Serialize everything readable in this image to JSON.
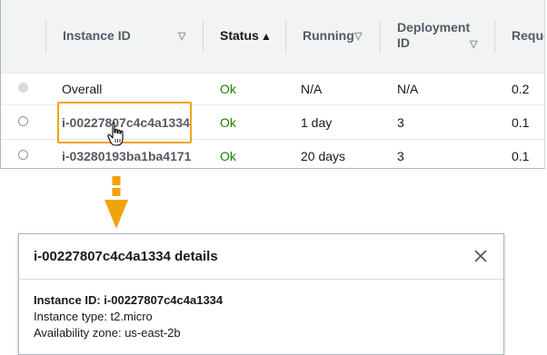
{
  "table": {
    "columns": [
      {
        "label": "Instance ID",
        "sort_icon": "triangle-down-icon"
      },
      {
        "label": "Status",
        "sort_icon": "triangle-up-icon",
        "active": true
      },
      {
        "label": "Running",
        "sort_icon": "triangle-down-icon"
      },
      {
        "label": "Deployment ID",
        "label_line1": "Deployment",
        "label_line2": "ID",
        "sort_icon": "triangle-down-icon"
      },
      {
        "label": "Reque"
      }
    ],
    "rows": [
      {
        "instance_id": "Overall",
        "status": "Ok",
        "running": "N/A",
        "deployment_id": "N/A",
        "requests": "0.2",
        "selectable": false
      },
      {
        "instance_id": "i-00227807c4c4a1334",
        "status": "Ok",
        "running": "1 day",
        "deployment_id": "3",
        "requests": "0.1",
        "selectable": true,
        "highlighted": true
      },
      {
        "instance_id": "i-03280193ba1ba4171",
        "status": "Ok",
        "running": "20 days",
        "deployment_id": "3",
        "requests": "0.1",
        "selectable": true
      }
    ]
  },
  "details": {
    "title": "i-00227807c4c4a1334 details",
    "instance_id_label": "Instance ID: i-00227807c4c4a1334",
    "instance_type": "Instance type: t2.micro",
    "availability_zone": "Availability zone: us-east-2b"
  },
  "colors": {
    "status_ok": "#1d8102",
    "highlight": "#f0a30a",
    "arrow": "#f0a30a"
  }
}
